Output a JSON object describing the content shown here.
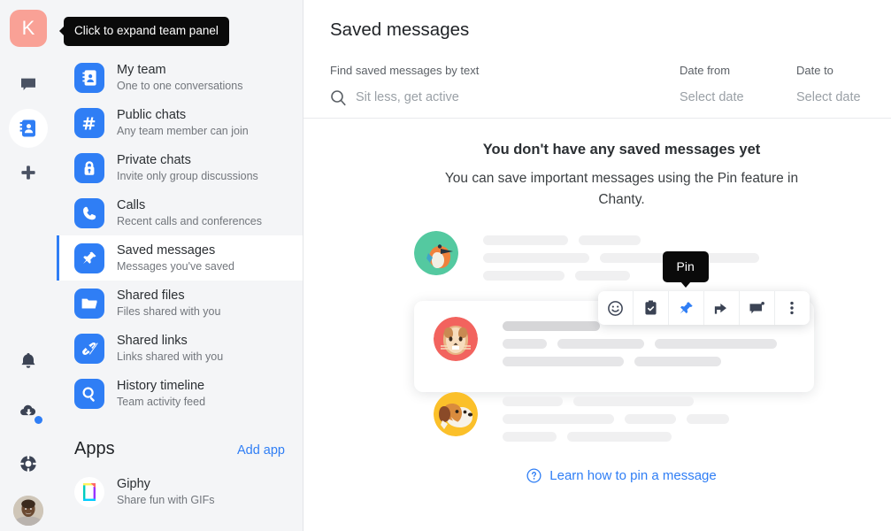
{
  "rail": {
    "team_initial": "K",
    "icons": [
      {
        "name": "chat-icon",
        "label": "Chats"
      },
      {
        "name": "contacts-icon",
        "label": "Contacts"
      },
      {
        "name": "plus-icon",
        "label": "Create new"
      }
    ],
    "bottom_icons": [
      {
        "name": "bell-icon",
        "label": "Notifications"
      },
      {
        "name": "cloud-download-icon",
        "label": "Downloads"
      },
      {
        "name": "lifebuoy-icon",
        "label": "Help"
      }
    ],
    "avatar_label": "User avatar"
  },
  "tooltip": {
    "text": "Click to expand team panel"
  },
  "nav": {
    "items": [
      {
        "icon": "contact-book-icon",
        "title": "My team",
        "sub": "One to one conversations",
        "selected": false
      },
      {
        "icon": "hash-icon",
        "title": "Public chats",
        "sub": "Any team member can join",
        "selected": false
      },
      {
        "icon": "lock-icon",
        "title": "Private chats",
        "sub": "Invite only group discussions",
        "selected": false
      },
      {
        "icon": "phone-icon",
        "title": "Calls",
        "sub": "Recent calls and conferences",
        "selected": false
      },
      {
        "icon": "pin-icon",
        "title": "Saved messages",
        "sub": "Messages you've saved",
        "selected": true
      },
      {
        "icon": "folder-icon",
        "title": "Shared files",
        "sub": "Files shared with you",
        "selected": false
      },
      {
        "icon": "link-icon",
        "title": "Shared links",
        "sub": "Links shared with you",
        "selected": false
      },
      {
        "icon": "search-icon",
        "title": "History timeline",
        "sub": "Team activity feed",
        "selected": false
      }
    ],
    "apps": {
      "heading": "Apps",
      "add_label": "Add app",
      "items": [
        {
          "icon": "giphy-icon",
          "title": "Giphy",
          "sub": "Share fun with GIFs"
        }
      ]
    }
  },
  "main": {
    "title": "Saved messages",
    "filters": {
      "search_label": "Find saved messages by text",
      "search_value": "Sit less, get active",
      "date_from_label": "Date from",
      "date_from_value": "Select date",
      "date_to_label": "Date to",
      "date_to_value": "Select date"
    },
    "empty_state": {
      "title": "You don't have any saved messages yet",
      "description": "You can save important messages using the Pin feature in Chanty."
    },
    "illustration": {
      "pin_tooltip": "Pin",
      "hover_actions": [
        {
          "name": "emoji-icon",
          "label": "Add reaction",
          "active": false
        },
        {
          "name": "task-clipboard-icon",
          "label": "Create task",
          "active": false
        },
        {
          "name": "pin-icon",
          "label": "Pin",
          "active": true
        },
        {
          "name": "share-icon",
          "label": "Forward",
          "active": false
        },
        {
          "name": "comment-icon",
          "label": "Reply in thread",
          "active": false
        },
        {
          "name": "more-vertical-icon",
          "label": "More",
          "active": false
        }
      ],
      "avatars": [
        {
          "name": "bird-avatar",
          "bg": "#54c9a0"
        },
        {
          "name": "cat-avatar",
          "bg": "#f2635e"
        },
        {
          "name": "dog-avatar",
          "bg": "#fbc02a"
        }
      ]
    },
    "learn_link": {
      "icon": "help-circle-icon",
      "text": "Learn how to pin a message"
    }
  },
  "colors": {
    "accent": "#2f7ef5",
    "panel_bg": "#f4f5f7",
    "avatar_bg": "#f9a196"
  }
}
